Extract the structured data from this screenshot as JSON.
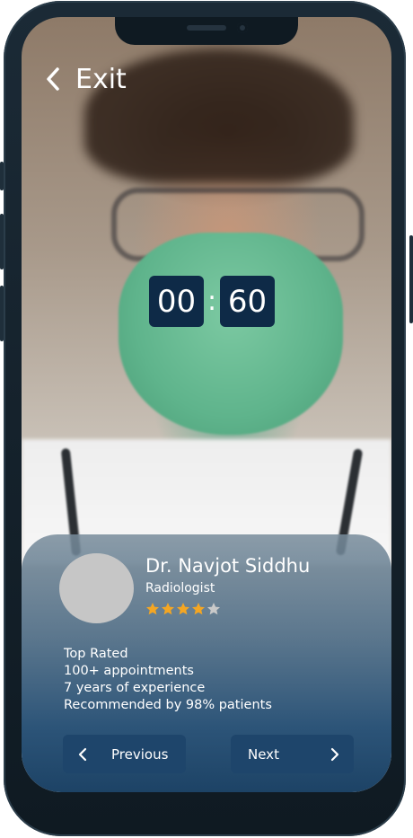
{
  "top_bar": {
    "exit_label": "Exit"
  },
  "timer": {
    "minutes": "00",
    "separator": ":",
    "seconds": "60"
  },
  "doctor": {
    "name": "Dr. Navjot Siddhu",
    "role": "Radiologist",
    "rating": 4,
    "rating_max": 5,
    "highlights": [
      "Top Rated",
      "100+ appointments",
      "7 years of experience",
      "Recommended by 98% patients"
    ]
  },
  "nav": {
    "previous_label": "Previous",
    "next_label": "Next"
  },
  "colors": {
    "timer_bg": "#0e2a47",
    "button_bg": "#1e456b",
    "star_filled": "#f4a623",
    "star_empty": "#c9c9c9",
    "frame": "#0f1a22"
  }
}
